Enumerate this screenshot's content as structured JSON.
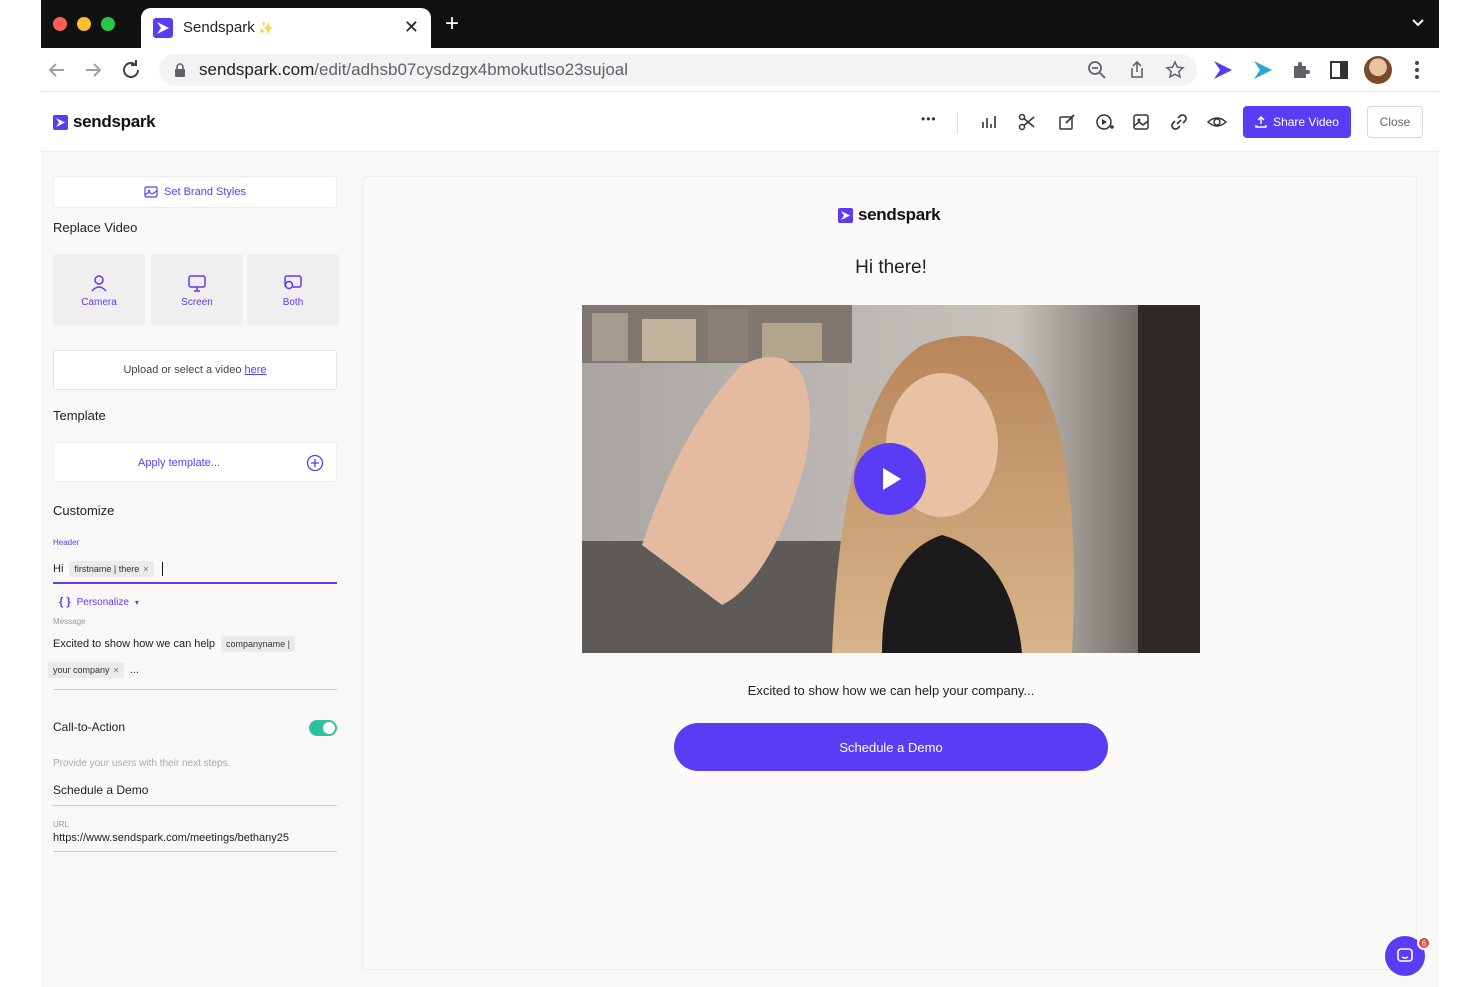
{
  "browser": {
    "tab_title": "Sendspark",
    "tab_sparkle": "✨",
    "tab_close": "✕",
    "new_tab": "+",
    "url_host": "sendspark.com",
    "url_path": "/edit/adhsb07cysdzgx4bmokutlso23sujoal"
  },
  "header": {
    "logo_text": "sendspark",
    "more_label": "•••",
    "share_label": "Share Video",
    "close_label": "Close"
  },
  "sidebar": {
    "brand_styles_label": "Set Brand Styles",
    "replace_video_title": "Replace Video",
    "replace_options": [
      {
        "label": "Camera"
      },
      {
        "label": "Screen"
      },
      {
        "label": "Both"
      }
    ],
    "upload_text": "Upload or select a video",
    "upload_link": "here",
    "template_title": "Template",
    "template_placeholder": "Apply template...",
    "customize_title": "Customize",
    "header_field_label": "Header",
    "header_prefix": "Hi",
    "header_chip": "firstname | there",
    "chip_remove": "×",
    "personalize_icon": "{ }",
    "personalize_label": "Personalize",
    "personalize_caret": "▾",
    "message_field_label": "Message",
    "message_prefix": "Excited to show how we can help",
    "message_chip_part1": "companyname |",
    "message_chip_part2": "your company",
    "message_suffix": "...",
    "cta_title": "Call-to-Action",
    "cta_enabled": true,
    "cta_hint": "Provide your users with their next steps.",
    "cta_text": "Schedule a Demo",
    "url_field_label": "URL",
    "url_value": "https://www.sendspark.com/meetings/bethany25"
  },
  "preview": {
    "logo_text": "sendspark",
    "greeting": "Hi there!",
    "message": "Excited to show how we can help your company...",
    "cta_label": "Schedule a Demo"
  },
  "chat": {
    "badge_count": "6"
  },
  "colors": {
    "brand": "#5b3cf5",
    "toggle_on": "#2fc2a0",
    "badge": "#e8454a"
  }
}
